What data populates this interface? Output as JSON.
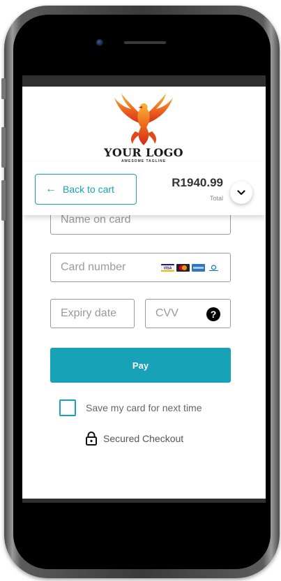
{
  "logo": {
    "title": "YOUR LOGO",
    "tagline": "AWESOME TAGLINE"
  },
  "summary": {
    "back_label": "Back to cart",
    "total_amount": "R1940.99",
    "total_label": "Total"
  },
  "form": {
    "name_placeholder": "Name on card",
    "card_number_placeholder": "Card number",
    "expiry_placeholder": "Expiry date",
    "cvv_placeholder": "CVV",
    "card_brands": [
      "visa-icon",
      "mastercard-icon",
      "amex-icon",
      "diners-icon"
    ]
  },
  "pay_label": "Pay",
  "save_card_label": "Save my card for next time",
  "save_card_checked": false,
  "secured_label": "Secured Checkout",
  "colors": {
    "accent": "#17a2b8",
    "text_dark": "#333333",
    "text_muted": "#9a9a9a"
  }
}
